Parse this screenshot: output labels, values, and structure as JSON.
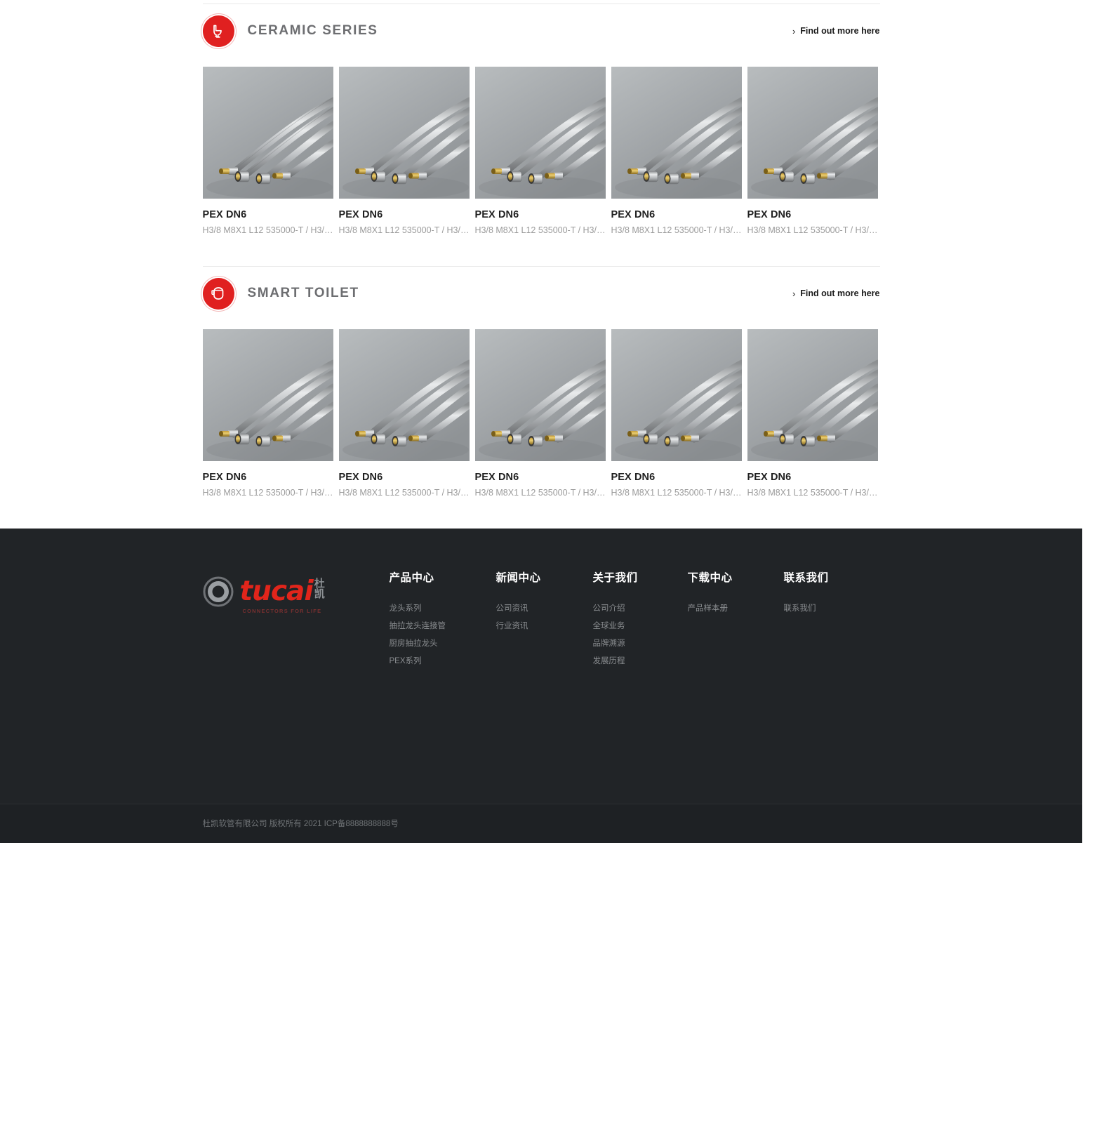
{
  "brand": {
    "accent": "#e02020",
    "logo_word": "tucai",
    "logo_cn_1": "杜",
    "logo_cn_2": "凯",
    "logo_tagline": "CONNECTORS FOR LIFE"
  },
  "sections": [
    {
      "id": "ceramic-series",
      "title": "CERAMIC SERIES",
      "icon": "toilet-icon",
      "more_label": "Find out more here",
      "more_chevron": "›",
      "banner_alt": "braided-hose-connectors-banner",
      "products": [
        {
          "title": "PEX DN6",
          "desc": "H3/8 M8X1 L12 535000-T / H3/8…"
        },
        {
          "title": "PEX DN6",
          "desc": "H3/8 M8X1 L12 535000-T / H3/8…"
        },
        {
          "title": "PEX DN6",
          "desc": "H3/8 M8X1 L12 535000-T / H3/8…"
        },
        {
          "title": "PEX DN6",
          "desc": "H3/8 M8X1 L12 535000-T / H3/8…"
        },
        {
          "title": "PEX DN6",
          "desc": "H3/8 M8X1 L12 535000-T / H3/8…"
        }
      ]
    },
    {
      "id": "smart-toilet",
      "title": "SMART TOILET",
      "icon": "smart-toilet-icon",
      "more_label": "Find out more here",
      "more_chevron": "›",
      "banner_alt": "braided-hose-connectors-banner",
      "products": [
        {
          "title": "PEX DN6",
          "desc": "H3/8 M8X1 L12 535000-T / H3/8…"
        },
        {
          "title": "PEX DN6",
          "desc": "H3/8 M8X1 L12 535000-T / H3/8…"
        },
        {
          "title": "PEX DN6",
          "desc": "H3/8 M8X1 L12 535000-T / H3/8…"
        },
        {
          "title": "PEX DN6",
          "desc": "H3/8 M8X1 L12 535000-T / H3/8…"
        },
        {
          "title": "PEX DN6",
          "desc": "H3/8 M8X1 L12 535000-T / H3/8…"
        }
      ]
    }
  ],
  "footer": {
    "columns": [
      {
        "heading": "产品中心",
        "links": [
          "龙头系列",
          "抽拉龙头连接管",
          "厨房抽拉龙头",
          "PEX系列"
        ]
      },
      {
        "heading": "新闻中心",
        "links": [
          "公司资讯",
          "行业资讯"
        ]
      },
      {
        "heading": "关于我们",
        "links": [
          "公司介绍",
          "全球业务",
          "品牌溯源",
          "发展历程"
        ]
      },
      {
        "heading": "下载中心",
        "links": [
          "产品样本册"
        ]
      },
      {
        "heading": "联系我们",
        "links": [
          "联系我们"
        ]
      }
    ],
    "copyright": "杜凯软管有限公司  版权所有 2021 ICP备8888888888号"
  }
}
